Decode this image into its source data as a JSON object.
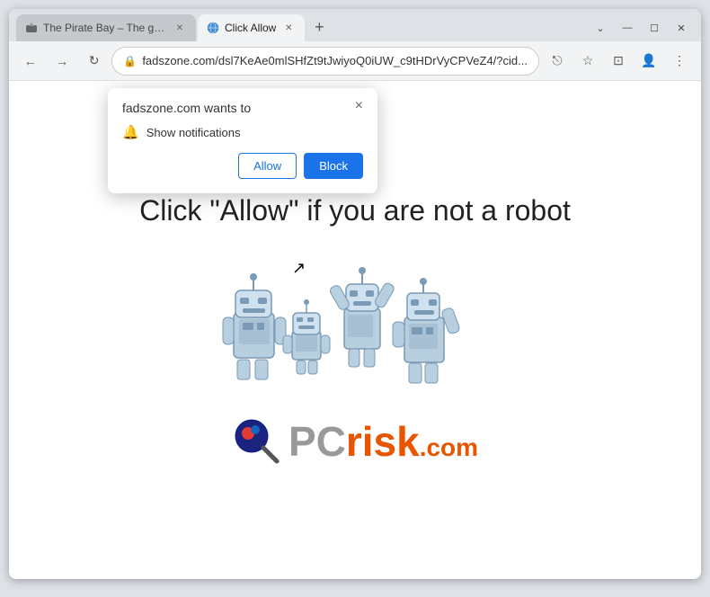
{
  "window": {
    "title": "Browser",
    "controls": {
      "minimize": "—",
      "maximize": "☐",
      "close": "✕"
    }
  },
  "tabs": [
    {
      "id": "tab1",
      "title": "The Pirate Bay – The galaxy's mo...",
      "active": false,
      "favicon": "pirate"
    },
    {
      "id": "tab2",
      "title": "Click Allow",
      "active": true,
      "favicon": "earth"
    }
  ],
  "newtab": "+",
  "nav": {
    "back": "←",
    "forward": "→",
    "reload": "↻",
    "address": "fadszone.com/dsl7KeAe0mlSHfZt9tJwiyoQ0iUW_c9tHDrVyCPVeZ4/?cid...",
    "lock": "🔒",
    "share": "⎋",
    "bookmark": "☆",
    "split": "⊡",
    "profile": "👤",
    "menu": "⋮"
  },
  "popup": {
    "title": "fadszone.com wants to",
    "close_btn": "×",
    "notification_label": "Show notifications",
    "bell": "🔔",
    "allow_btn": "Allow",
    "block_btn": "Block"
  },
  "page": {
    "main_text": "Click \"Allow\"   if you are not   a robot"
  },
  "logo": {
    "pc": "PC",
    "risk": "risk",
    "dotcom": ".com"
  }
}
